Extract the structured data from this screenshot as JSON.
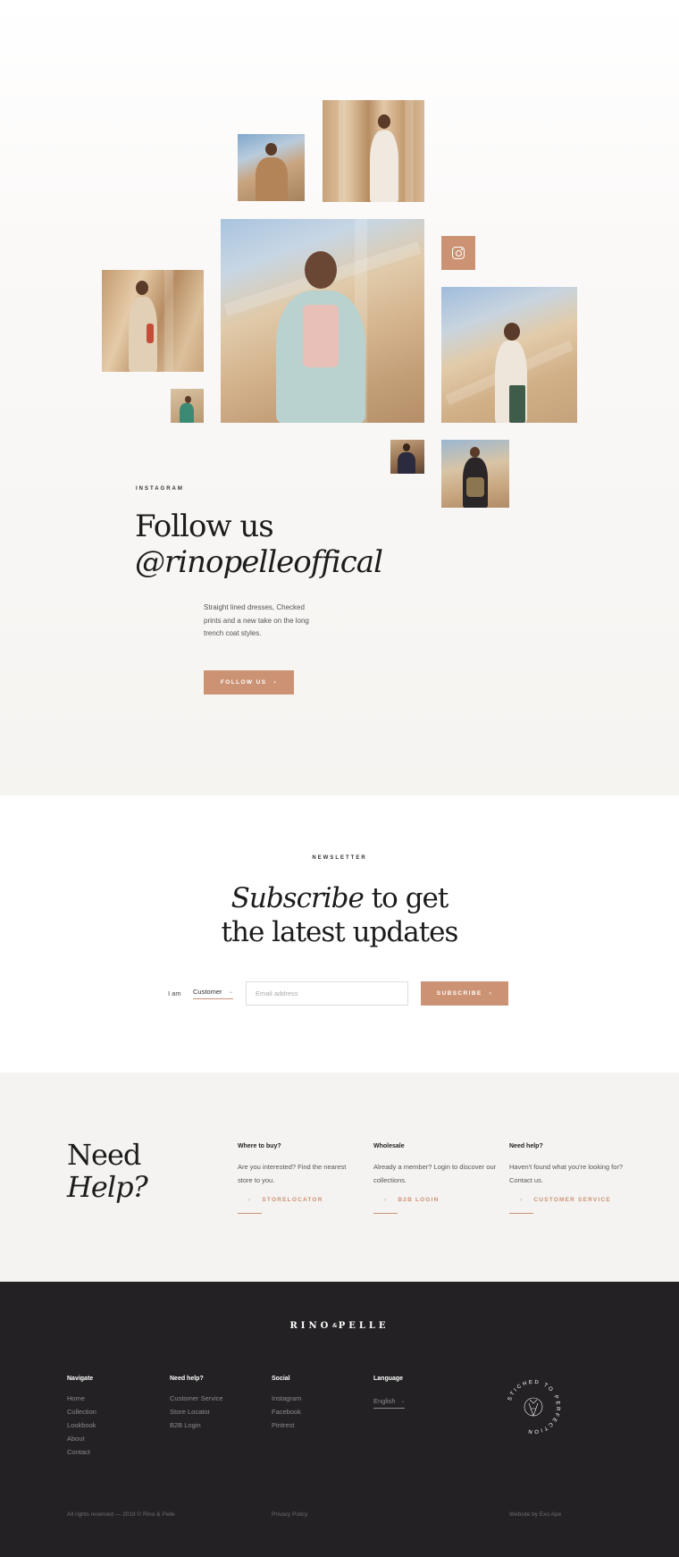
{
  "instagram": {
    "eyebrow": "INSTAGRAM",
    "title_line1": "Follow us",
    "title_line2": "@rinopelleoffical",
    "description": "Straight lined dresses, Checked prints and a new take on the long trench coat styles.",
    "button_label": "FOLLOW US",
    "button_icon": "chevron-right-icon",
    "tile_icon": "instagram-icon"
  },
  "newsletter": {
    "eyebrow": "NEWSLETTER",
    "title_italic": "Subscribe",
    "title_rest": " to get",
    "title_line2": "the latest updates",
    "i_am_label": "I am",
    "customer_value": "Customer",
    "email_placeholder": "Email address",
    "subscribe_label": "SUBSCRIBE"
  },
  "help": {
    "title_line1": "Need",
    "title_line2": "Help?",
    "columns": [
      {
        "heading": "Where to buy?",
        "text": "Are you interested? Find the nearest store to you.",
        "link": "STORELOCATOR"
      },
      {
        "heading": "Wholesale",
        "text": "Already a member? Login to discover our collections.",
        "link": "B2B LOGIN"
      },
      {
        "heading": "Need help?",
        "text": "Haven't found what you're looking for? Contact us.",
        "link": "CUSTOMER SERVICE"
      }
    ]
  },
  "footer": {
    "brand_left": "RINO",
    "brand_amp": "&",
    "brand_right": "PELLE",
    "navigate": {
      "heading": "Navigate",
      "items": [
        "Home",
        "Collection",
        "Lookbook",
        "About",
        "Contact"
      ]
    },
    "needhelp": {
      "heading": "Need help?",
      "items": [
        "Customer Service",
        "Store Locator",
        "B2B Login"
      ]
    },
    "social": {
      "heading": "Social",
      "items": [
        "Instagram",
        "Facebook",
        "Pintrest"
      ]
    },
    "language": {
      "heading": "Language",
      "value": "English"
    },
    "badge_text": "STICHED TO PERFECTION",
    "copyright": "All rights reserved — 2019 © Rino & Pelle",
    "privacy": "Privacy Policy",
    "credit": "Website by Exo Ape"
  },
  "colors": {
    "accent": "#cc9274",
    "footer_bg": "#232123",
    "help_bg": "#f4f3f1"
  }
}
